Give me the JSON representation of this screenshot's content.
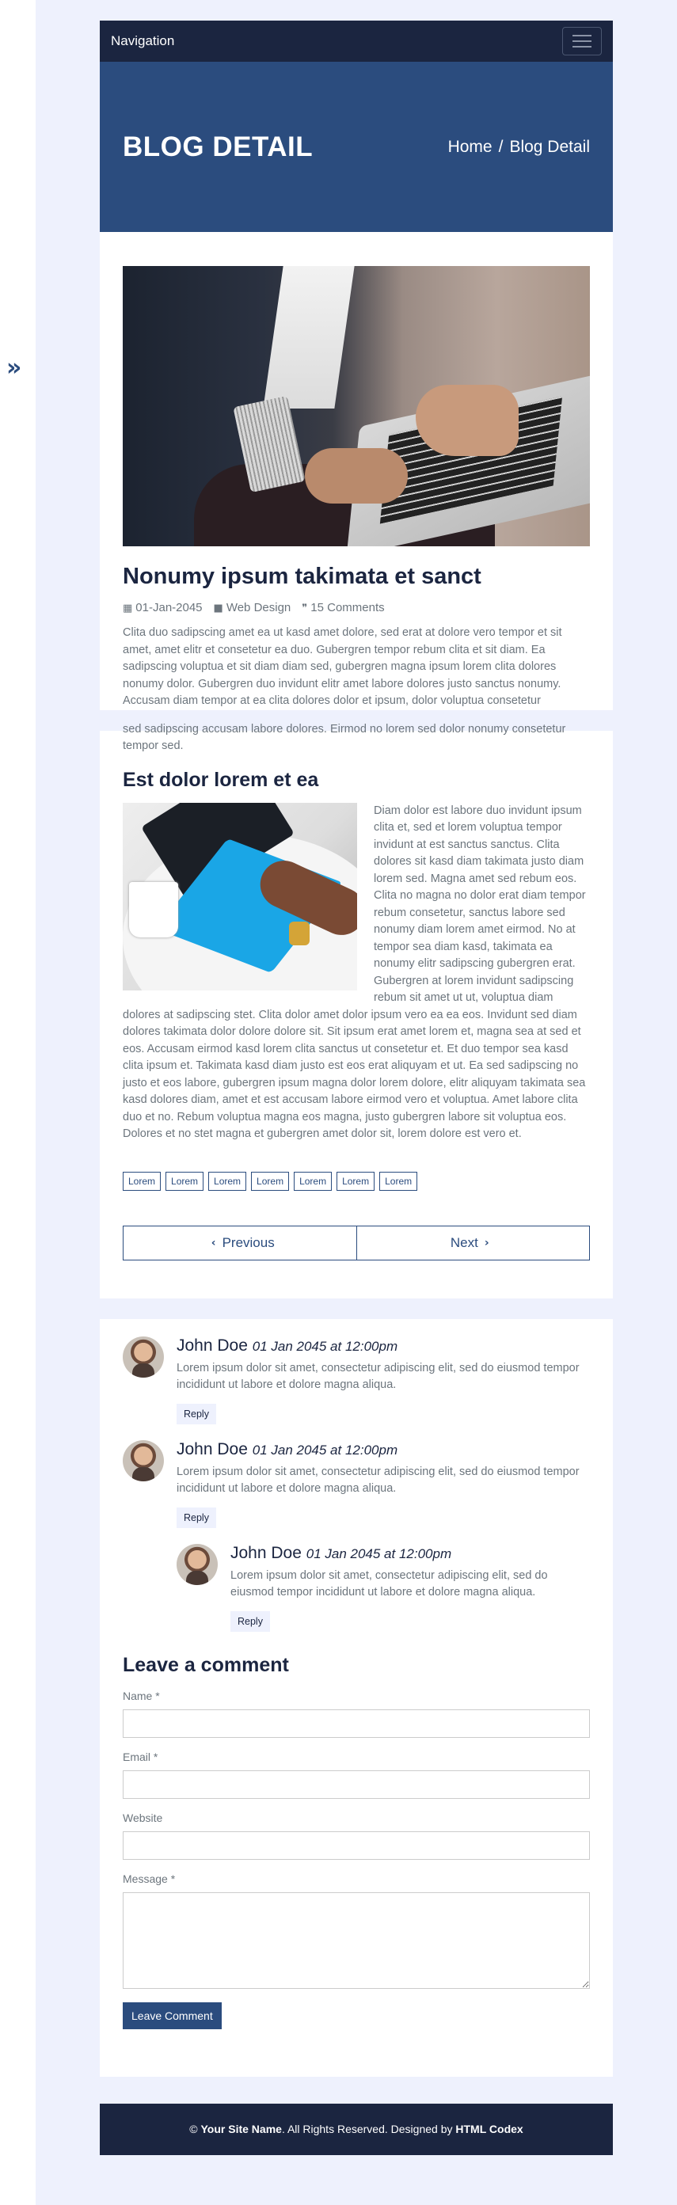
{
  "navbar": {
    "brand": "Navigation"
  },
  "hero": {
    "title": "BLOG DETAIL",
    "breadcrumb_home": "Home",
    "breadcrumb_sep": "/",
    "breadcrumb_current": "Blog Detail"
  },
  "post": {
    "title": "Nonumy ipsum takimata et sanct",
    "date": "01-Jan-2045",
    "category": "Web Design",
    "comments": "15 Comments",
    "paragraph1": "Clita duo sadipscing amet ea ut kasd amet dolore, sed erat at dolore vero tempor et sit amet, amet elitr et consetetur ea duo. Gubergren tempor rebum clita et sit diam. Ea sadipscing voluptua et sit diam diam sed, gubergren magna ipsum lorem clita dolores nonumy dolor. Gubergren duo invidunt elitr amet labore dolores justo sanctus nonumy. Accusam diam tempor at ea clita dolores dolor et ipsum, dolor voluptua consetetur",
    "paragraph1_cont": "sed sadipscing accusam labore dolores. Eirmod no lorem sed dolor nonumy consetetur tempor sed.",
    "subheading": "Est dolor lorem et ea",
    "paragraph2": "Diam dolor est labore duo invidunt ipsum clita et, sed et lorem voluptua tempor invidunt at est sanctus sanctus. Clita dolores sit kasd diam takimata justo diam lorem sed. Magna amet sed rebum eos. Clita no magna no dolor erat diam tempor rebum consetetur, sanctus labore sed nonumy diam lorem amet eirmod. No at tempor sea diam kasd, takimata ea nonumy elitr sadipscing gubergren erat. Gubergren at lorem invidunt sadipscing rebum sit amet ut ut, voluptua diam dolores at sadipscing stet. Clita dolor amet dolor ipsum vero ea ea eos. Invidunt sed diam dolores takimata dolor dolore dolore sit. Sit ipsum erat amet lorem et, magna sea at sed et eos. Accusam eirmod kasd lorem clita sanctus ut consetetur et. Et duo tempor sea kasd clita ipsum et. Takimata kasd diam justo est eos erat aliquyam et ut. Ea sed sadipscing no justo et eos labore, gubergren ipsum magna dolor lorem dolore, elitr aliquyam takimata sea kasd dolores diam, amet et est accusam labore eirmod vero et voluptua. Amet labore clita duo et no. Rebum voluptua magna eos magna, justo gubergren labore sit voluptua eos. Dolores et no stet magna et gubergren amet dolor sit, lorem dolore est vero et.",
    "tags": [
      "Lorem",
      "Lorem",
      "Lorem",
      "Lorem",
      "Lorem",
      "Lorem",
      "Lorem"
    ],
    "prev_label": "Previous",
    "next_label": "Next"
  },
  "comments": [
    {
      "name": "John Doe",
      "date": "01 Jan 2045 at 12:00pm",
      "text": "Lorem ipsum dolor sit amet, consectetur adipiscing elit, sed do eiusmod tempor incididunt ut labore et dolore magna aliqua.",
      "reply": "Reply"
    },
    {
      "name": "John Doe",
      "date": "01 Jan 2045 at 12:00pm",
      "text": "Lorem ipsum dolor sit amet, consectetur adipiscing elit, sed do eiusmod tempor incididunt ut labore et dolore magna aliqua.",
      "reply": "Reply"
    },
    {
      "name": "John Doe",
      "date": "01 Jan 2045 at 12:00pm",
      "text": "Lorem ipsum dolor sit amet, consectetur adipiscing elit, sed do eiusmod tempor incididunt ut labore et dolore magna aliqua.",
      "reply": "Reply"
    }
  ],
  "form": {
    "heading": "Leave a comment",
    "name_label": "Name *",
    "email_label": "Email *",
    "website_label": "Website",
    "message_label": "Message *",
    "submit_label": "Leave Comment"
  },
  "footer": {
    "copy": "©",
    "site_name": "Your Site Name",
    "rights": ". All Rights Reserved. Designed by",
    "codex": "HTML Codex"
  },
  "colors": {
    "navy": "#1b2540",
    "primary": "#2b4c7e",
    "page_bg": "#eef1fd"
  },
  "icons": {
    "side_toggle": "double-chevron-right-icon",
    "calendar": "calendar-icon",
    "folder": "folder-icon",
    "comments": "comments-icon"
  }
}
